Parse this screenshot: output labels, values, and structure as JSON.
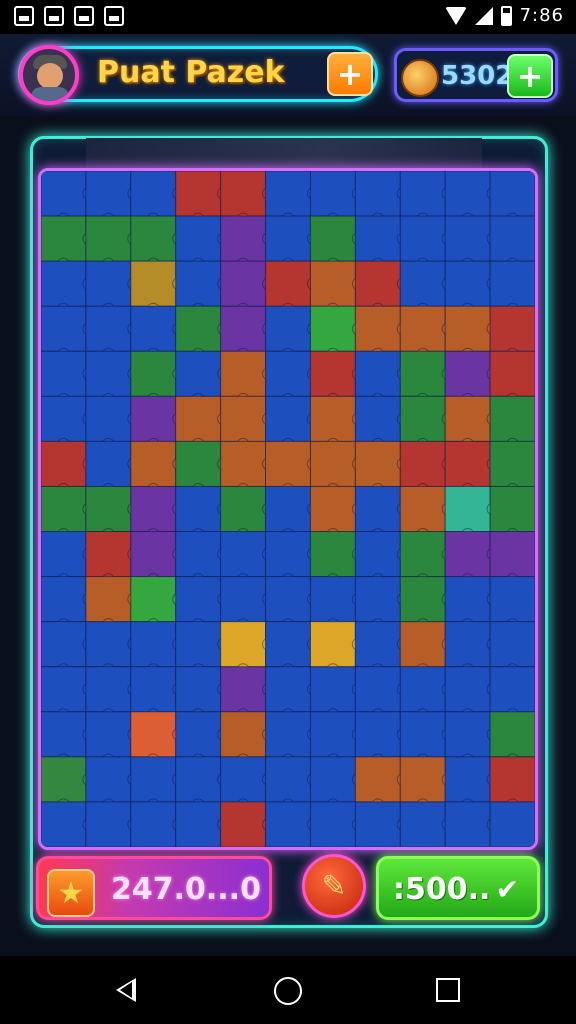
{
  "header": {
    "title": "Puat Pazek",
    "title_plus_label": "+",
    "coins": "5302",
    "coins_plus_label": "+"
  },
  "footer": {
    "score": "247.0...0",
    "progress_label": ":500..",
    "check_glyph": "✔",
    "pencil_glyph": "✎",
    "star_glyph": "★"
  },
  "status_bar": {
    "time": "7:86"
  },
  "board": {
    "rows": 15,
    "cols": 11,
    "base_color": "#1f5ad0",
    "grid_colors": [
      [
        "#1f5ad0",
        "#1f5ad0",
        "#1f5ad0",
        "#d23a2a",
        "#d23a2a",
        "#1f5ad0",
        "#1f5ad0",
        "#1f5ad0",
        "#1f5ad0",
        "#1f5ad0",
        "#1f5ad0"
      ],
      [
        "#2f9a3a",
        "#2f9a3a",
        "#2f9a3a",
        "#1f5ad0",
        "#7a3ab0",
        "#1f5ad0",
        "#2f9a3a",
        "#1f5ad0",
        "#1f5ad0",
        "#1f5ad0",
        "#1f5ad0"
      ],
      [
        "#1f5ad0",
        "#1f5ad0",
        "#d0a020",
        "#1f5ad0",
        "#7a3ab0",
        "#d23a2a",
        "#d46a20",
        "#d23a2a",
        "#1f5ad0",
        "#1f5ad0",
        "#1f5ad0"
      ],
      [
        "#1f5ad0",
        "#1f5ad0",
        "#1f5ad0",
        "#2f9a3a",
        "#7a3ab0",
        "#1f5ad0",
        "#3ac03a",
        "#d46a20",
        "#d46a20",
        "#d46a20",
        "#d23a2a"
      ],
      [
        "#1f5ad0",
        "#1f5ad0",
        "#2f9a3a",
        "#1f5ad0",
        "#d46a20",
        "#1f5ad0",
        "#d23a2a",
        "#1f5ad0",
        "#2f9a3a",
        "#7a3ab0",
        "#d23a2a"
      ],
      [
        "#1f5ad0",
        "#1f5ad0",
        "#7a3ab0",
        "#d46a20",
        "#d46a20",
        "#1f5ad0",
        "#d46a20",
        "#1f5ad0",
        "#2f9a3a",
        "#d46a20",
        "#2f9a3a"
      ],
      [
        "#d23a2a",
        "#1f5ad0",
        "#d46a20",
        "#2f9a3a",
        "#d46a20",
        "#d46a20",
        "#d46a20",
        "#d46a20",
        "#d23a2a",
        "#d23a2a",
        "#2f9a3a"
      ],
      [
        "#2f9a3a",
        "#2f9a3a",
        "#7a3ab0",
        "#1f5ad0",
        "#2f9a3a",
        "#1f5ad0",
        "#d46a20",
        "#1f5ad0",
        "#d46a20",
        "#3ad0a0",
        "#2f9a3a"
      ],
      [
        "#1f5ad0",
        "#d23a2a",
        "#7a3ab0",
        "#1f5ad0",
        "#1f5ad0",
        "#1f5ad0",
        "#2f9a3a",
        "#1f5ad0",
        "#2f9a3a",
        "#7a3ab0",
        "#7a3ab0"
      ],
      [
        "#1f5ad0",
        "#d46a20",
        "#3ac03a",
        "#1f5ad0",
        "#1f5ad0",
        "#1f5ad0",
        "#1f5ad0",
        "#1f5ad0",
        "#2f9a3a",
        "#1f5ad0",
        "#1f5ad0"
      ],
      [
        "#1f5ad0",
        "#1f5ad0",
        "#1f5ad0",
        "#1f5ad0",
        "#ffc020",
        "#1f5ad0",
        "#ffc020",
        "#1f5ad0",
        "#d46a20",
        "#1f5ad0",
        "#1f5ad0"
      ],
      [
        "#1f5ad0",
        "#1f5ad0",
        "#1f5ad0",
        "#1f5ad0",
        "#7a3ab0",
        "#1f5ad0",
        "#1f5ad0",
        "#1f5ad0",
        "#1f5ad0",
        "#1f5ad0",
        "#1f5ad0"
      ],
      [
        "#1f5ad0",
        "#1f5ad0",
        "#ff6a30",
        "#1f5ad0",
        "#d46a20",
        "#1f5ad0",
        "#1f5ad0",
        "#1f5ad0",
        "#1f5ad0",
        "#1f5ad0",
        "#2f9a3a"
      ],
      [
        "#3a9a3a",
        "#1f5ad0",
        "#1f5ad0",
        "#1f5ad0",
        "#1f5ad0",
        "#1f5ad0",
        "#1f5ad0",
        "#d46a20",
        "#d46a20",
        "#1f5ad0",
        "#d23a2a"
      ],
      [
        "#1f5ad0",
        "#1f5ad0",
        "#1f5ad0",
        "#1f5ad0",
        "#d23a2a",
        "#1f5ad0",
        "#1f5ad0",
        "#1f5ad0",
        "#1f5ad0",
        "#1f5ad0",
        "#1f5ad0"
      ]
    ]
  }
}
